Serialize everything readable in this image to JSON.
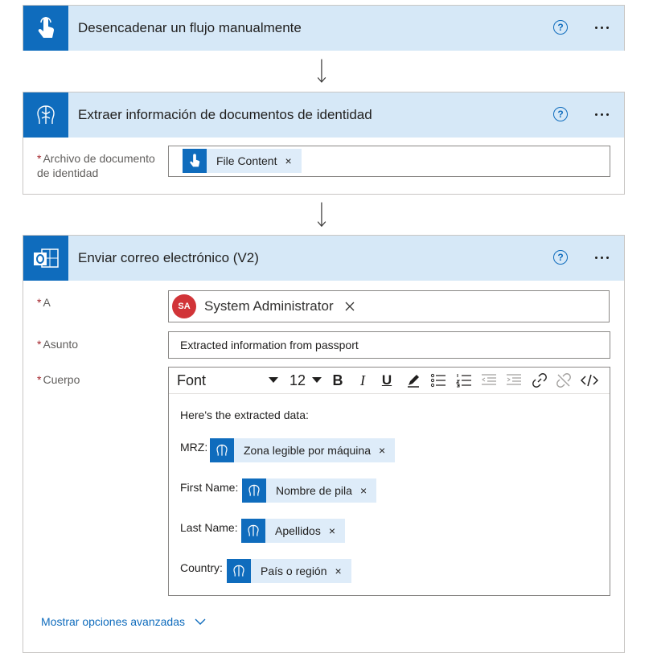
{
  "steps": [
    {
      "title": "Desencadenar un flujo manualmente",
      "icon": "hand-touch-icon",
      "icon_bg": "#0f6cbd"
    },
    {
      "title": "Extraer información de documentos de identidad",
      "icon": "ai-builder-brain-icon",
      "icon_bg": "#0f6cbd",
      "fields": {
        "document_label_line1": "Archivo de documento",
        "document_label_line2": "de identidad",
        "document_token": "File Content"
      }
    },
    {
      "title": "Enviar correo electrónico (V2)",
      "icon": "outlook-icon",
      "icon_bg": "#0f6cbd",
      "fields": {
        "to_label": "A",
        "to_avatar_initials": "SA",
        "to_value": "System Administrator",
        "subject_label": "Asunto",
        "subject_value": "Extracted information from passport",
        "body_label": "Cuerpo"
      },
      "editor": {
        "font": "Font",
        "size": "12",
        "intro": "Here's the extracted data:",
        "lines": [
          {
            "label": "MRZ:",
            "token": "Zona legible por máquina"
          },
          {
            "label": "First Name:",
            "token": "Nombre de pila"
          },
          {
            "label": "Last Name:",
            "token": "Apellidos"
          },
          {
            "label": "Country:",
            "token": "País o región"
          }
        ]
      },
      "advanced_link": "Mostrar opciones avanzadas"
    }
  ],
  "common": {
    "help_glyph": "?",
    "required_mark": "*",
    "remove_glyph": "×"
  },
  "colors": {
    "header_bg": "#d6e8f7",
    "accent": "#0f6cbd",
    "token_bg": "#deecf9",
    "avatar_bg": "#d13438",
    "required": "#a4262c"
  }
}
